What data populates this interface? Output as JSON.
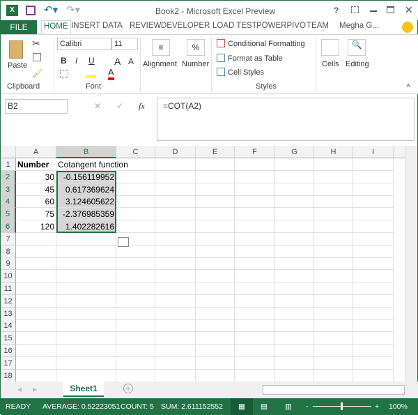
{
  "window": {
    "title": "Book2 - Microsoft Excel Preview",
    "help": "?"
  },
  "ribbon_tabs": [
    "FILE",
    "HOME",
    "INSERT",
    "DATA",
    "REVIEW",
    "DEVELOPER",
    "LOAD TEST",
    "POWERPIVO",
    "TEAM",
    "Megha G..."
  ],
  "clipboard": {
    "paste": "Paste",
    "label": "Clipboard"
  },
  "font": {
    "name": "Calibri",
    "size": "11",
    "label": "Font",
    "bold": "B",
    "italic": "I",
    "underline": "U",
    "grow": "A",
    "shrink": "A"
  },
  "alignment": "Alignment",
  "number": {
    "label": "Number",
    "symbol": "%"
  },
  "styles": {
    "conditional": "Conditional Formatting",
    "table": "Format as Table",
    "cell": "Cell Styles",
    "label": "Styles"
  },
  "cells": "Cells",
  "editing": "Editing",
  "formula_bar": {
    "name_box": "B2",
    "fx": "fx",
    "formula": "=COT(A2)"
  },
  "columns": [
    "A",
    "B",
    "C",
    "D",
    "E",
    "F",
    "G",
    "H",
    "I"
  ],
  "rows": [
    [
      "Number",
      "Cotangent function"
    ],
    [
      "30",
      "-0.156119952"
    ],
    [
      "45",
      "0.617369624"
    ],
    [
      "60",
      "3.124605622"
    ],
    [
      "75",
      "-2.376985359"
    ],
    [
      "120",
      "1.402282616"
    ]
  ],
  "row_count": 18,
  "sheet_tab": "Sheet1",
  "status": {
    "ready": "READY",
    "average": "AVERAGE: 0.52223051",
    "count": "COUNT: 5",
    "sum": "SUM: 2.611152552",
    "zoom": "100%",
    "zoom_percent": 100
  },
  "colors": {
    "accent": "#217346"
  }
}
